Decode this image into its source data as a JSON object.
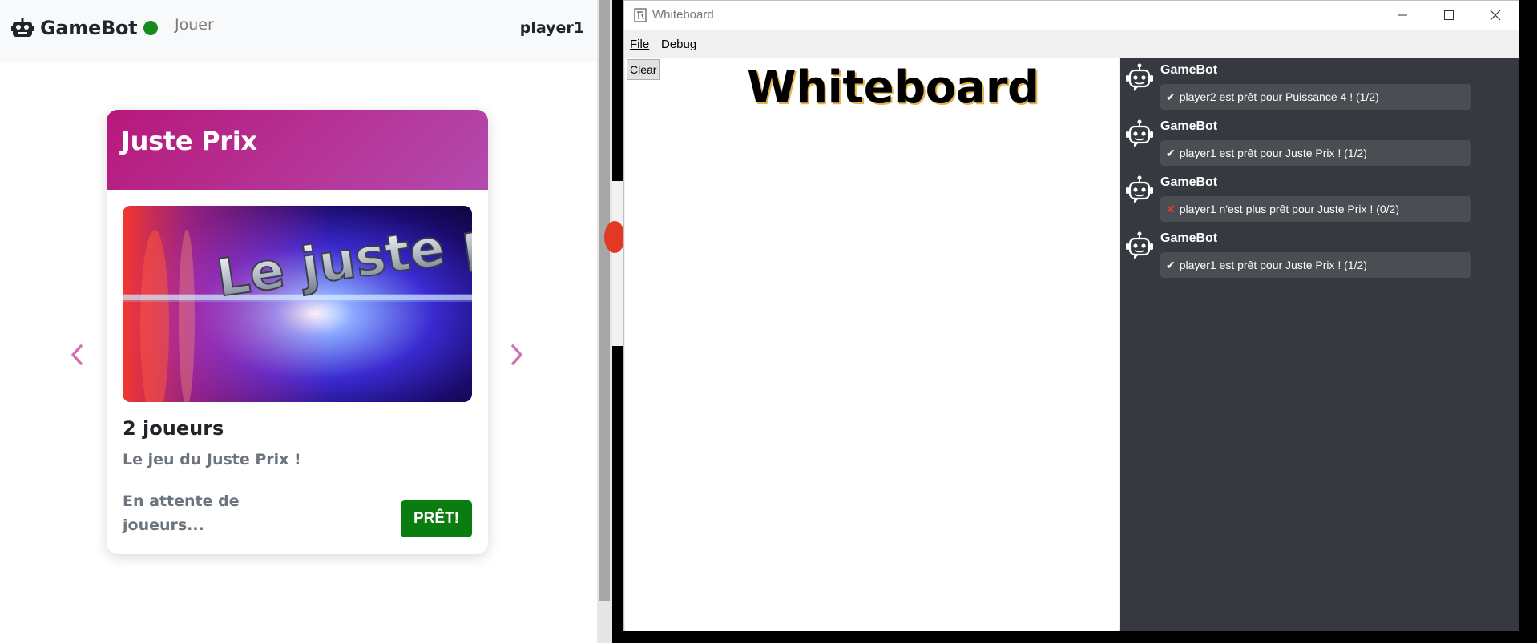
{
  "browser": {
    "navbar": {
      "brand": "GameBot",
      "nav_play": "Jouer",
      "username": "player1"
    },
    "card": {
      "title": "Juste Prix",
      "image_text": "Le juste prix",
      "players": "2 joueurs",
      "description": "Le jeu du Juste Prix !",
      "status": "En attente de joueurs...",
      "ready_button": "PRÊT!"
    },
    "colors": {
      "header_start": "#b7187a",
      "header_end": "#b44aae",
      "ready": "#0b7d10",
      "online": "#198a1f",
      "arrow": "#d36fb3"
    }
  },
  "whiteboard": {
    "window_title": "Whiteboard",
    "menu": {
      "file": "File",
      "debug": "Debug"
    },
    "clear_button": "Clear",
    "heading": "Whiteboard",
    "messages": [
      {
        "author": "GameBot",
        "mark": "✔",
        "type": "ok",
        "text": "player2 est prêt pour Puissance 4 ! (1/2)"
      },
      {
        "author": "GameBot",
        "mark": "✔",
        "type": "ok",
        "text": "player1 est prêt pour Juste Prix ! (1/2)"
      },
      {
        "author": "GameBot",
        "mark": "✕",
        "type": "no",
        "text": "player1 n'est plus prêt pour Juste Prix ! (0/2)"
      },
      {
        "author": "GameBot",
        "mark": "✔",
        "type": "ok",
        "text": "player1 est prêt pour Juste Prix ! (1/2)"
      }
    ]
  },
  "icons": {
    "brand": "robot-icon",
    "prev": "chevron-left-icon",
    "next": "chevron-right-icon",
    "minimize": "minimize-icon",
    "maximize": "maximize-icon",
    "close": "close-icon",
    "avatar": "robot-avatar-icon"
  }
}
